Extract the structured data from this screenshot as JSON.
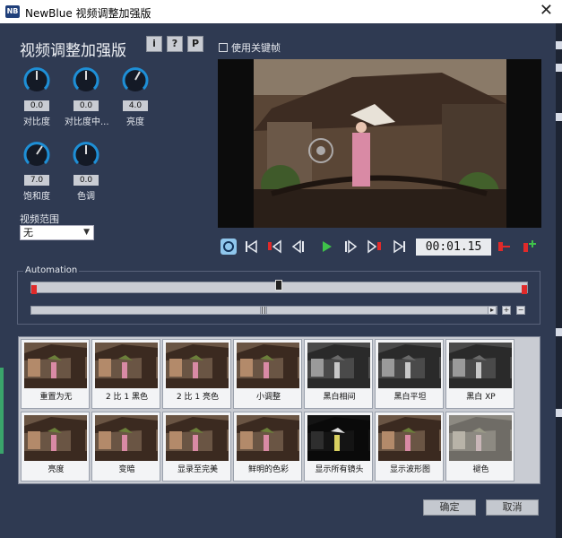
{
  "window": {
    "app_icon": "NB",
    "title": "NewBlue 视频调整加强版",
    "close_glyph": "✕"
  },
  "panel": {
    "heading": "视频调整加强版",
    "buttons": [
      {
        "label": "i"
      },
      {
        "label": "?"
      },
      {
        "label": "P"
      }
    ],
    "knobs": [
      {
        "value": "0.0",
        "label": "对比度"
      },
      {
        "value": "0.0",
        "label": "对比度中..."
      },
      {
        "value": "4.0",
        "label": "亮度"
      },
      {
        "value": "7.0",
        "label": "饱和度"
      },
      {
        "value": "0.0",
        "label": "色调"
      }
    ],
    "range": {
      "label": "视频范围",
      "selected": "无"
    },
    "keyframe_checkbox": "使用关键帧"
  },
  "transport": {
    "timecode": "00:01.15",
    "icons": [
      "loop-icon",
      "go-start-icon",
      "prev-keyframe-icon",
      "step-back-icon",
      "play-icon",
      "step-forward-icon",
      "next-keyframe-icon",
      "go-end-icon",
      "remove-keyframe-icon",
      "add-keyframe-icon"
    ]
  },
  "automation": {
    "label": "Automation"
  },
  "presets": [
    {
      "label": "重置为无",
      "tone": "color"
    },
    {
      "label": "2 比 1 黑色",
      "tone": "color"
    },
    {
      "label": "2 比 1 亮色",
      "tone": "color"
    },
    {
      "label": "小调整",
      "tone": "color"
    },
    {
      "label": "黑白相间",
      "tone": "bw"
    },
    {
      "label": "黑白平坦",
      "tone": "bw"
    },
    {
      "label": "黑白 XP",
      "tone": "bw"
    },
    {
      "label": "亮度",
      "tone": "color"
    },
    {
      "label": "变暗",
      "tone": "color"
    },
    {
      "label": "显录至完美",
      "tone": "color"
    },
    {
      "label": "鲜明的色彩",
      "tone": "color"
    },
    {
      "label": "显示所有镜头",
      "tone": "dark"
    },
    {
      "label": "显示波形图",
      "tone": "color"
    },
    {
      "label": "褪色",
      "tone": "faded"
    }
  ],
  "dialog": {
    "ok": "确定",
    "cancel": "取消"
  },
  "colors": {
    "accent": "#1e8fd6",
    "keyframe": "#e02a2a",
    "play": "#3fc24a"
  }
}
